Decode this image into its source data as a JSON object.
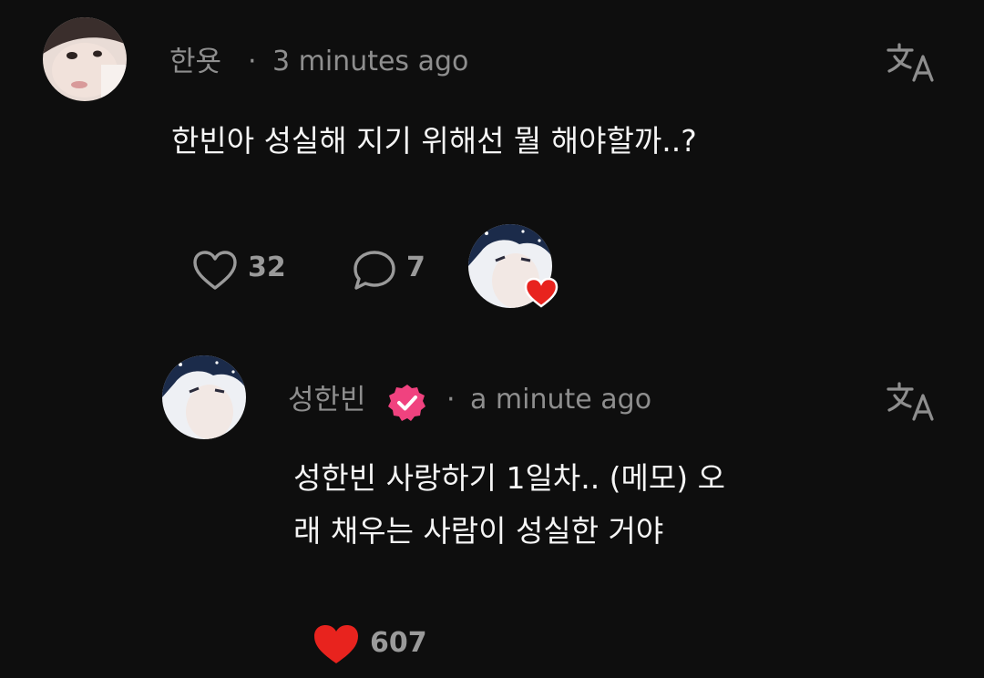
{
  "comment": {
    "author": "한욧",
    "dot": "·",
    "time": "3 minutes ago",
    "text": "한빈아 성실해 지기 위해선 뭘 해야할까..?",
    "like_count": "32",
    "reply_count": "7",
    "creator_heart": "heart-icon"
  },
  "reply": {
    "author": "성한빈",
    "dot": "·",
    "time": "a minute ago",
    "text_line1": "성한빈 사랑하기 1일차.. (메모) 오",
    "text_line2": "래 채우는 사람이 성실한 거야",
    "like_count": "607",
    "liked": true,
    "heart_color": "#e8231e"
  },
  "colors": {
    "verified": "#f0427f",
    "background": "#0e0e0e"
  }
}
